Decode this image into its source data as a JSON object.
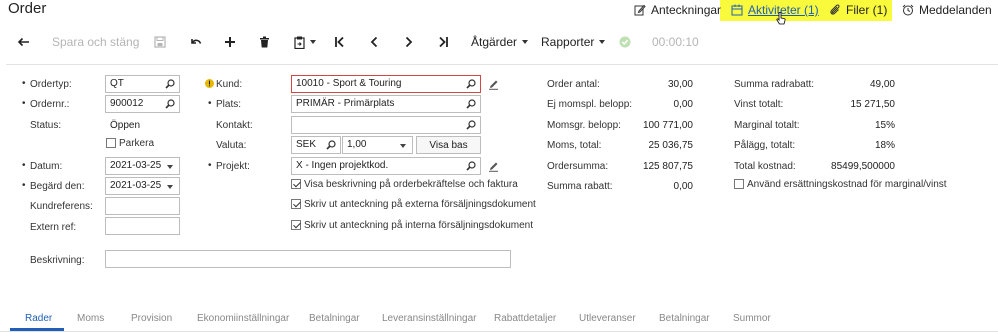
{
  "page": {
    "title": "Order"
  },
  "header_links": {
    "notes": "Anteckningar",
    "activities": "Aktiviteter (1)",
    "files": "Filer (1)",
    "messages": "Meddelanden"
  },
  "toolbar": {
    "save_close": "Spara och stäng",
    "actions": "Åtgärder",
    "reports": "Rapporter",
    "timer": "00:00:10"
  },
  "form": {
    "order_type": {
      "label": "Ordertyp:",
      "value": "QT"
    },
    "order_nbr": {
      "label": "Ordernr.:",
      "value": "900012"
    },
    "status": {
      "label": "Status:",
      "value": "Öppen"
    },
    "hold": {
      "label": "Parkera",
      "checked": false
    },
    "date": {
      "label": "Datum:",
      "value": "2021-03-25"
    },
    "requested_on": {
      "label": "Begärd den:",
      "value": "2021-03-25"
    },
    "customer_ref": {
      "label": "Kundreferens:",
      "value": ""
    },
    "external_ref": {
      "label": "Extern ref:",
      "value": ""
    },
    "description": {
      "label": "Beskrivning:",
      "value": ""
    },
    "customer": {
      "label": "Kund:",
      "value": "10010 - Sport & Touring"
    },
    "location": {
      "label": "Plats:",
      "value": "PRIMÄR - Primärplats"
    },
    "contact": {
      "label": "Kontakt:",
      "value": ""
    },
    "currency": {
      "label": "Valuta:",
      "value": "SEK",
      "rate": "1,00",
      "button": "Visa bas"
    },
    "project": {
      "label": "Projekt:",
      "value": "X - Ingen projektkod."
    },
    "check_print_desc": {
      "label": "Visa beskrivning på orderbekräftelse och faktura",
      "checked": true
    },
    "check_ext_notes": {
      "label": "Skriv ut anteckning på externa försäljningsdokument",
      "checked": true
    },
    "check_int_notes": {
      "label": "Skriv ut anteckning på interna försäljningsdokument",
      "checked": true
    }
  },
  "totals_mid": [
    {
      "label": "Order antal:",
      "value": "30,00"
    },
    {
      "label": "Ej momspl. belopp:",
      "value": "0,00"
    },
    {
      "label": "Momsgr. belopp:",
      "value": "100 771,00"
    },
    {
      "label": "Moms, total:",
      "value": "25 036,75"
    },
    {
      "label": "Ordersumma:",
      "value": "125 807,75"
    },
    {
      "label": "Summa rabatt:",
      "value": "0,00"
    }
  ],
  "totals_right": [
    {
      "label": "Summa radrabatt:",
      "value": "49,00"
    },
    {
      "label": "Vinst totalt:",
      "value": "15 271,50"
    },
    {
      "label": "Marginal totalt:",
      "value": "15%"
    },
    {
      "label": "Pålägg, totalt:",
      "value": "18%"
    },
    {
      "label": "Total kostnad:",
      "value": "85499,500000"
    }
  ],
  "replacement_cost": {
    "label": "Använd ersättningskostnad för marginal/vinst",
    "checked": false
  },
  "tabs": [
    "Rader",
    "Moms",
    "Provision",
    "Ekonomiinställningar",
    "Betalningar",
    "Leveransinställningar",
    "Rabattdetaljer",
    "Utleveranser",
    "Betalningar",
    "Summor"
  ],
  "colors": {
    "accent": "#1f5fb8",
    "highlight": "#fafa3c",
    "error_border": "#d64545",
    "disabled": "#b5b5b5"
  },
  "icons": [
    "pencil-note-icon",
    "calendar-icon",
    "paperclip-icon",
    "alarm-clock-icon",
    "back-arrow-icon",
    "save-icon",
    "undo-icon",
    "plus-icon",
    "trash-icon",
    "clipboard-icon",
    "first-icon",
    "prev-icon",
    "next-icon",
    "last-icon",
    "check-circle-icon",
    "search-icon",
    "warning-icon",
    "edit-pencil-icon"
  ]
}
